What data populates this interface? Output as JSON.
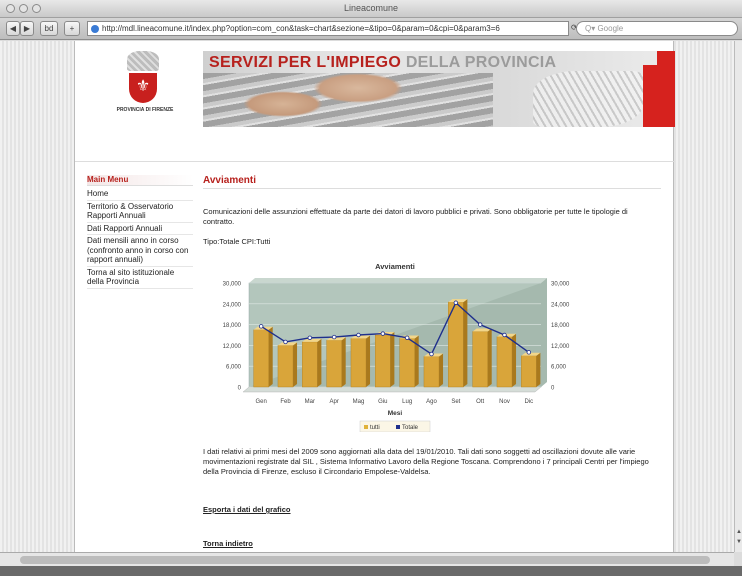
{
  "browser": {
    "window_title": "Lineacomune",
    "back_label": "◀",
    "forward_label": "▶",
    "bookmarks_label": "bd",
    "add_label": "+",
    "url": "http://mdl.lineacomune.it/index.php?option=com_con&task=chart&sezione=&tipo=0&param=0&cpi=0&param3=6",
    "refresh_label": "⟳",
    "search_placeholder": "Q▾ Google"
  },
  "header": {
    "logo_caption": "PROVINCIA DI FIRENZE",
    "title_red": "SERVIZI PER L'IMPIEGO",
    "title_grey": "DELLA PROVINCIA"
  },
  "sidebar": {
    "title": "Main Menu",
    "items": [
      {
        "label": "Home"
      },
      {
        "label": "Territorio & Osservatorio Rapporti Annuali"
      },
      {
        "label": "Dati Rapporti Annuali"
      },
      {
        "label": "Dati mensili anno in corso (confronto anno in corso con rapport annuali)"
      },
      {
        "label": "Torna al sito istituzionale della Provincia"
      }
    ]
  },
  "main": {
    "title": "Avviamenti",
    "description": "Comunicazioni delle assunzioni effettuate da parte dei datori di lavoro pubblici e privati. Sono obbligatorie per tutte le tipologie di contratto.",
    "filter": "Tipo:Totale CPI:Tutti",
    "note": "I dati relativi ai primi mesi del 2009 sono aggiornati alla data del 19/01/2010. Tali dati sono soggetti ad oscillazioni dovute alle varie movimentazioni registrate dal SIL , Sistema Informativo Lavoro della Regione Toscana. Comprendono i 7 principali Centri per l'impiego della Provincia di Firenze, escluso il Circondario Empolese-Valdelsa.",
    "export_link": "Esporta i dati del grafico",
    "back_link": "Torna indietro"
  },
  "chart_data": {
    "type": "bar",
    "title": "Avviamenti",
    "xlabel": "Mesi",
    "categories": [
      "Gen",
      "Feb",
      "Mar",
      "Apr",
      "Mag",
      "Giu",
      "Lug",
      "Ago",
      "Set",
      "Ott",
      "Nov",
      "Dic"
    ],
    "series": [
      {
        "name": "tutti",
        "kind": "bar",
        "color": "#e0b23a",
        "values": [
          16500,
          12000,
          13000,
          13500,
          14000,
          15000,
          14000,
          8800,
          24500,
          16000,
          14500,
          9000
        ]
      },
      {
        "name": "Totale",
        "kind": "line",
        "color": "#1f2f8c",
        "values": [
          17500,
          13000,
          14200,
          14400,
          15000,
          15400,
          14200,
          9500,
          24300,
          18000,
          15000,
          10000
        ]
      }
    ],
    "yticks": [
      0,
      6000,
      12000,
      18000,
      24000,
      30000
    ],
    "ytick_labels": [
      "0",
      "6,000",
      "12,000",
      "18,000",
      "24,000",
      "30,000"
    ],
    "ylim": [
      0,
      30000
    ],
    "legend": "bottom-center",
    "grid": true
  }
}
